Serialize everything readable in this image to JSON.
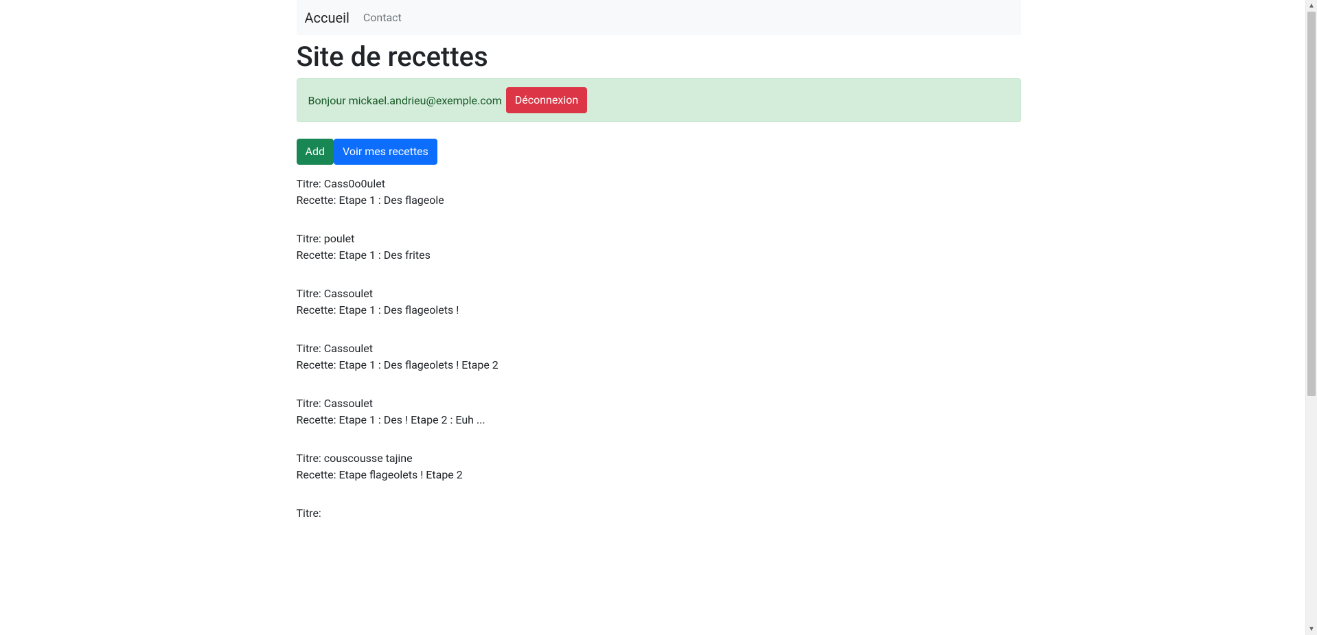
{
  "nav": {
    "brand": "Accueil",
    "contact": "Contact"
  },
  "heading": "Site de recettes",
  "alert": {
    "greeting": "Bonjour mickael.andrieu@exemple.com",
    "logout": "Déconnexion"
  },
  "actions": {
    "add": "Add",
    "view_mine": "Voir mes recettes"
  },
  "labels": {
    "title_prefix": "Titre: ",
    "recipe_prefix": "Recette: "
  },
  "recipes": [
    {
      "title": "Cass0o0ulet",
      "body": "Etape 1 : Des flageole"
    },
    {
      "title": "poulet",
      "body": "Etape 1 : Des frites"
    },
    {
      "title": "Cassoulet",
      "body": "Etape 1 : Des flageolets !"
    },
    {
      "title": "Cassoulet",
      "body": "Etape 1 : Des flageolets ! Etape 2"
    },
    {
      "title": "Cassoulet",
      "body": "Etape 1 : Des ! Etape 2 : Euh ..."
    },
    {
      "title": "couscousse tajine",
      "body": "Etape flageolets ! Etape 2"
    },
    {
      "title": "",
      "body": ""
    }
  ]
}
